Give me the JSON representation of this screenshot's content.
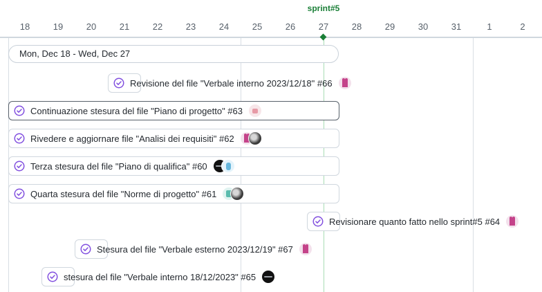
{
  "timeline": {
    "days": [
      "18",
      "19",
      "20",
      "21",
      "22",
      "23",
      "24",
      "25",
      "26",
      "27",
      "28",
      "29",
      "30",
      "31",
      "1",
      "2"
    ],
    "milestone": "sprint#5",
    "date_range": "Mon, Dec 18 - Wed, Dec 27"
  },
  "items": [
    {
      "title": "Revisione del file \"Verbale interno 2023/12/18\" #66",
      "status_icon": "issue-closed-icon",
      "assignees": [
        "pink-avatar"
      ]
    },
    {
      "title": "Continuazione stesura del file \"Piano di progetto\" #63",
      "status_icon": "issue-closed-icon",
      "assignees": [
        "robot-avatar"
      ]
    },
    {
      "title": "Rivedere e aggiornare file \"Analisi dei requisiti\" #62",
      "status_icon": "issue-closed-icon",
      "assignees": [
        "pink-avatar",
        "photo-avatar"
      ]
    },
    {
      "title": "Terza stesura del file \"Piano di qualifica\" #60",
      "status_icon": "issue-closed-icon",
      "assignees": [
        "dark-avatar",
        "blue-avatar"
      ]
    },
    {
      "title": "Quarta stesura del file \"Norme di progetto\" #61",
      "status_icon": "issue-closed-icon",
      "assignees": [
        "teal-avatar",
        "photo-avatar"
      ]
    },
    {
      "title": "Revisionare quanto fatto nello sprint#5 #64",
      "status_icon": "issue-closed-icon",
      "assignees": [
        "pink-avatar"
      ]
    },
    {
      "title": "Stesura del file \"Verbale esterno 2023/12/19\" #67",
      "status_icon": "issue-closed-icon",
      "assignees": [
        "pink-avatar"
      ]
    },
    {
      "title": "stesura del file \"Verbale interno 18/12/2023\" #65",
      "status_icon": "issue-closed-icon",
      "assignees": [
        "dark-avatar"
      ]
    }
  ],
  "colors": {
    "accent": "#8250df",
    "milestone": "#1a7f37",
    "border": "#d0d7de"
  }
}
